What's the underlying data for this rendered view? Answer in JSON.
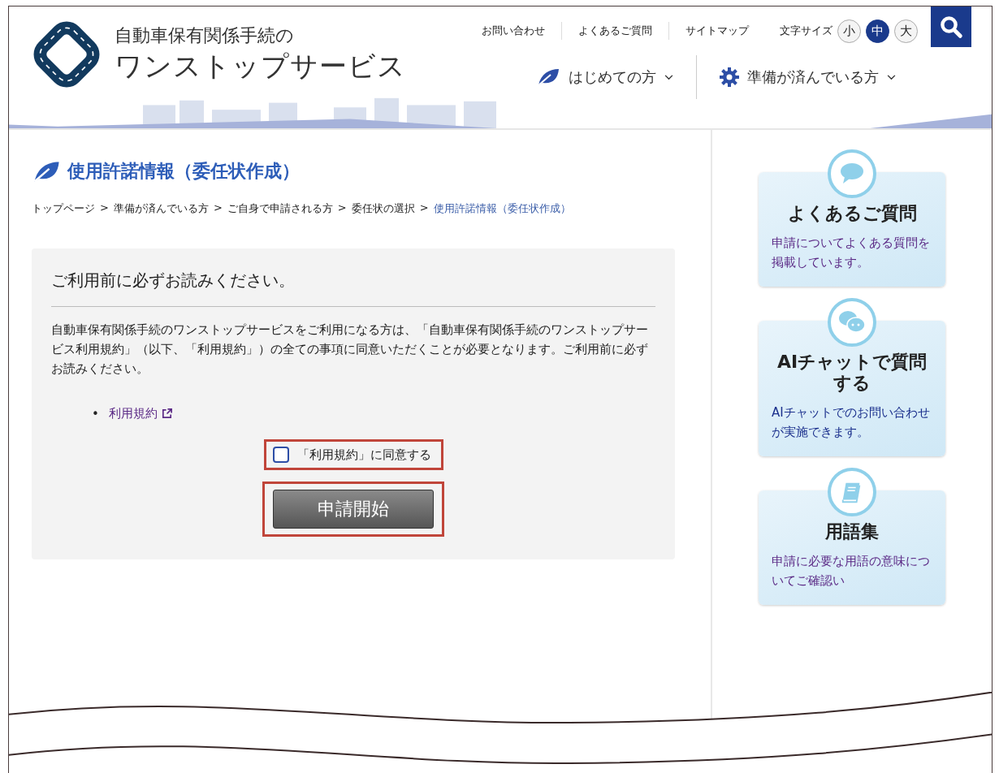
{
  "header": {
    "logo_line1": "自動車保有関係手続の",
    "logo_line2": "ワンストップサービス",
    "utility_links": [
      "お問い合わせ",
      "よくあるご質問",
      "サイトマップ"
    ],
    "font_size": {
      "label": "文字サイズ",
      "options": [
        {
          "label": "小",
          "selected": false
        },
        {
          "label": "中",
          "selected": true
        },
        {
          "label": "大",
          "selected": false
        }
      ]
    },
    "nav": [
      {
        "label": "はじめての方",
        "kind": "leaf"
      },
      {
        "label": "準備が済んでいる方",
        "kind": "gear"
      }
    ]
  },
  "page_title": "使用許諾情報（委任状作成）",
  "breadcrumb": {
    "separator": ">",
    "items": [
      {
        "label": "トップページ",
        "current": false
      },
      {
        "label": "準備が済んでいる方",
        "current": false
      },
      {
        "label": "ご自身で申請される方",
        "current": false
      },
      {
        "label": "委任状の選択",
        "current": false
      },
      {
        "label": "使用許諾情報（委任状作成）",
        "current": true
      }
    ]
  },
  "notice": {
    "heading": "ご利用前に必ずお読みください。",
    "body": "自動車保有関係手続のワンストップサービスをご利用になる方は、「自動車保有関係手続のワンストップサービス利用規約」（以下、「利用規約」）の全ての事項に同意いただくことが必要となります。ご利用前に必ずお読みください。",
    "links": [
      {
        "marker": "•",
        "label": "利用規約",
        "visited": true
      }
    ],
    "agree": {
      "label": "「利用規約」に同意する",
      "checked": false,
      "annotated": true
    },
    "submit": {
      "label": "申請開始",
      "annotated": true
    }
  },
  "sidebar": [
    {
      "kind": "faq",
      "title": "よくあるご質問",
      "description": "申請についてよくある質問を掲載しています。",
      "visited": true
    },
    {
      "kind": "chat",
      "title": "AIチャットで質問する",
      "description": "AIチャットでのお問い合わせが実施できます。",
      "visited": false
    },
    {
      "kind": "glossary",
      "title": "用語集",
      "description": "申請に必要な用語の意味についてご確認い",
      "visited": true
    }
  ]
}
